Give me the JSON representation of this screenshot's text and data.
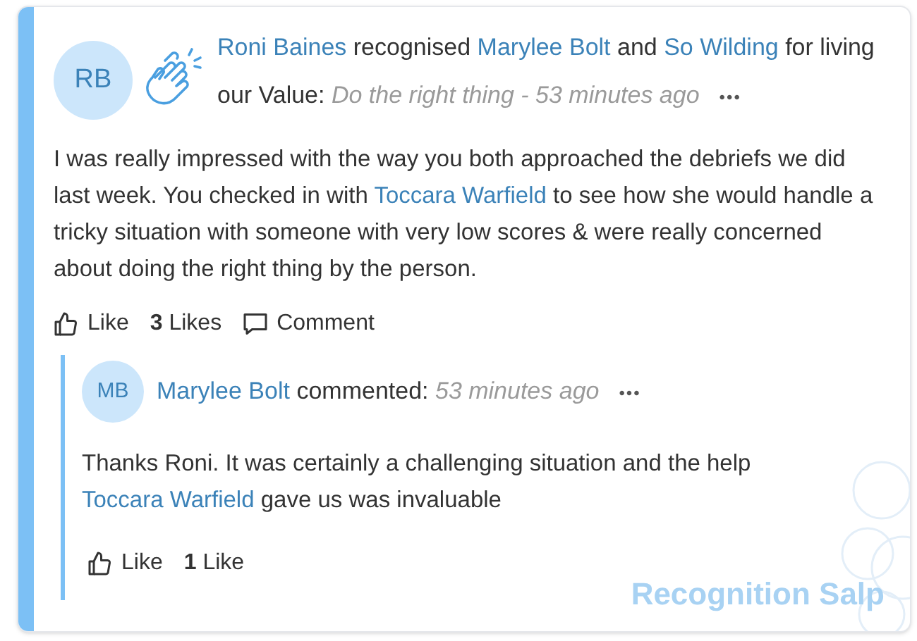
{
  "post": {
    "avatar": "RB",
    "headline": [
      {
        "kind": "link",
        "text": "Roni Baines"
      },
      {
        "kind": "plain",
        "text": " recognised "
      },
      {
        "kind": "link",
        "text": "Marylee Bolt"
      },
      {
        "kind": "plain",
        "text": " and "
      },
      {
        "kind": "link",
        "text": "So Wilding"
      },
      {
        "kind": "plain",
        "text": " for living our Value: "
      },
      {
        "kind": "meta",
        "text": "Do the right thing - 53 minutes ago"
      }
    ],
    "more": "•••",
    "body": [
      {
        "kind": "plain",
        "text": "I was really impressed with the way you both approached the debriefs we did last week. You checked in with "
      },
      {
        "kind": "link",
        "text": "Toccara Warfield"
      },
      {
        "kind": "plain",
        "text": " to see how she would handle a tricky situation with someone with very low scores & were really concerned about doing the right thing by the person."
      }
    ],
    "actions": [
      {
        "kind": "like",
        "label": "Like"
      },
      {
        "kind": "count",
        "label": "**3** Likes"
      },
      {
        "kind": "comment",
        "label": "Comment"
      }
    ]
  },
  "comments": [
    {
      "avatar": "MB",
      "headline": [
        {
          "kind": "link",
          "text": "Marylee Bolt"
        },
        {
          "kind": "plain",
          "text": " commented: "
        },
        {
          "kind": "meta",
          "text": "53 minutes ago"
        }
      ],
      "more": "•••",
      "body": [
        {
          "kind": "plain",
          "text": "Thanks Roni. It was certainly a challenging situation and the help "
        },
        {
          "kind": "link",
          "text": "Toccara Warfield"
        },
        {
          "kind": "plain",
          "text": " gave us was invaluable"
        }
      ],
      "actions": [
        {
          "kind": "like",
          "label": "Like"
        },
        {
          "kind": "count",
          "label": "**1** Like"
        }
      ]
    }
  ],
  "brand": "Recognition Salp"
}
